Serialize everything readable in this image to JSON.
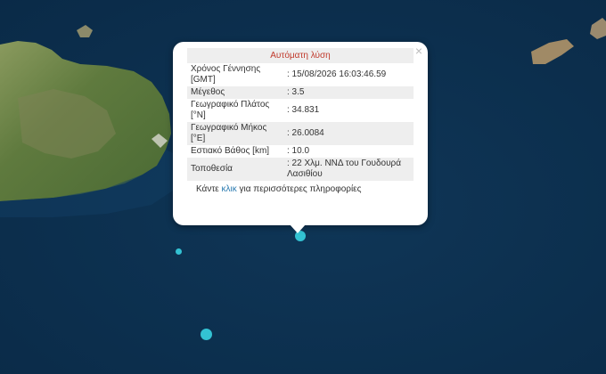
{
  "popup": {
    "title": "Αυτόματη λύση",
    "close_glyph": "×",
    "rows": [
      {
        "label": "Χρόνος Γέννησης [GMT]",
        "value": ": 15/08/2026 16:03:46.59"
      },
      {
        "label": "Μέγεθος",
        "value": ": 3.5"
      },
      {
        "label": "Γεωγραφικό Πλάτος [°N]",
        "value": ": 34.831"
      },
      {
        "label": "Γεωγραφικό Μήκος [°E]",
        "value": ": 26.0084"
      },
      {
        "label": "Εστιακό Βάθος [km]",
        "value": ": 10.0"
      },
      {
        "label": "Τοποθεσία",
        "value": ": 22 Χλμ. ΝΝΔ του Γουδουρά Λασιθίου"
      }
    ],
    "more_prefix": "Κάντε ",
    "more_link": "κλικ",
    "more_suffix": " για περισσότερες πληροφορίες"
  },
  "colors": {
    "sea": "#0b2f4f",
    "marker": "#33c2d3",
    "title_red": "#c0392b"
  }
}
